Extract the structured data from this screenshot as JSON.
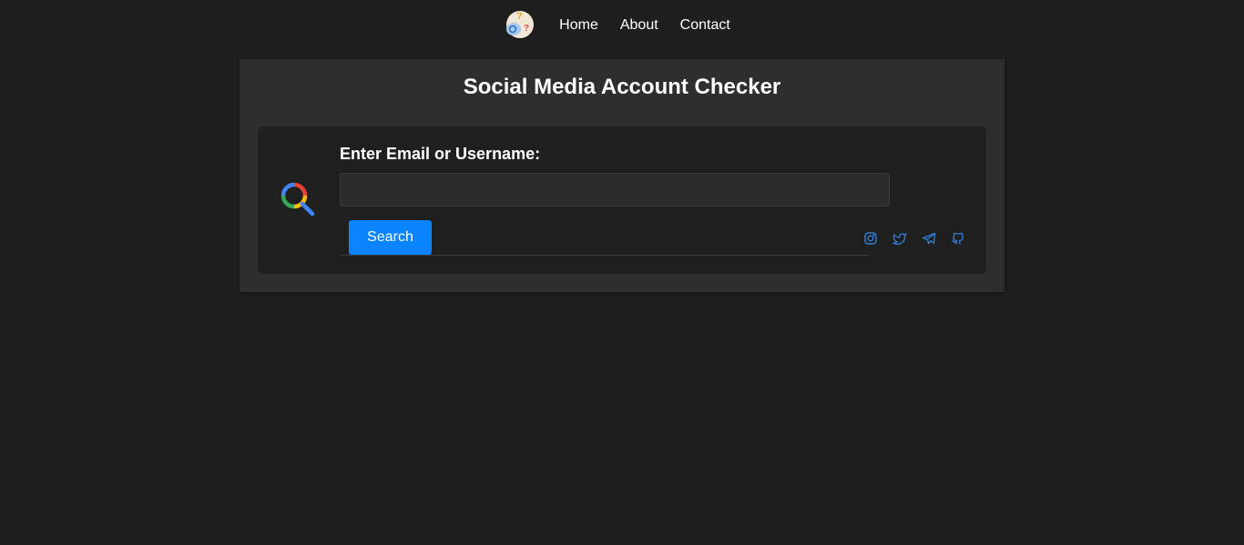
{
  "nav": {
    "items": [
      {
        "label": "Home"
      },
      {
        "label": "About"
      },
      {
        "label": "Contact"
      }
    ]
  },
  "main": {
    "title": "Social Media Account Checker",
    "label": "Enter Email or Username:",
    "input_value": "",
    "button_label": "Search",
    "socials": [
      "instagram-icon",
      "twitter-icon",
      "telegram-icon",
      "github-icon"
    ]
  },
  "colors": {
    "background": "#1e1e1e",
    "card": "#2e2e2e",
    "inner_card": "#1f1f1f",
    "accent": "#0a84ff",
    "social_icon": "#2f7fd8"
  }
}
